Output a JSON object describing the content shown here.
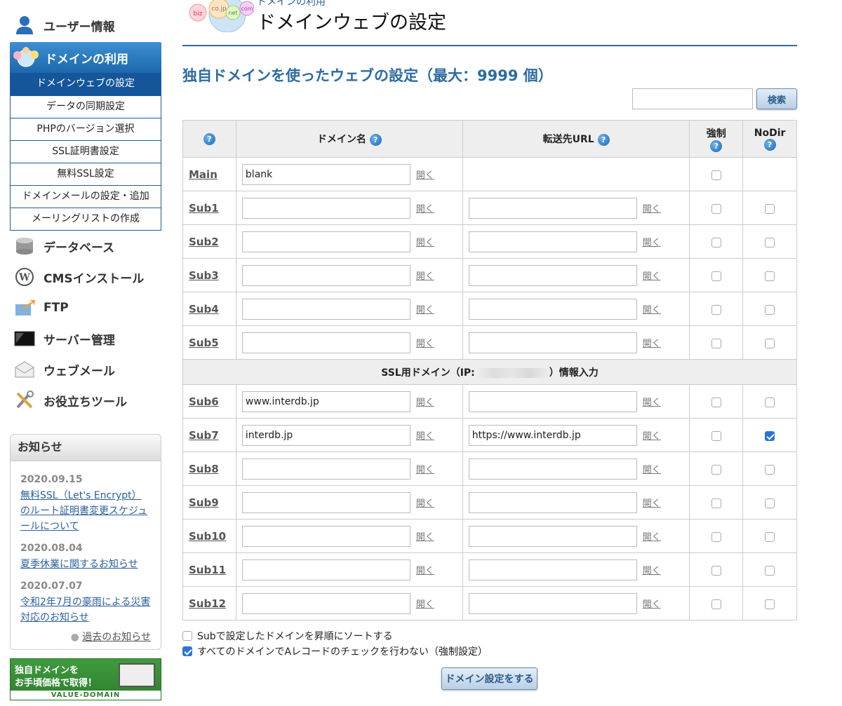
{
  "sidebar": {
    "user_info": "ユーザー情報",
    "domain_use": "ドメインの利用",
    "sub_items": [
      "ドメインウェブの設定",
      "データの同期設定",
      "PHPのバージョン選択",
      "SSL証明書設定",
      "無料SSL設定",
      "ドメインメールの設定・追加",
      "メーリングリストの作成"
    ],
    "main_items": [
      "データベース",
      "CMSインストール",
      "FTP",
      "サーバー管理",
      "ウェブメール",
      "お役立ちツール"
    ]
  },
  "news": {
    "title": "お知らせ",
    "items": [
      {
        "date": "2020.09.15",
        "text": "無料SSL（Let's Encrypt）のルート証明書変更スケジュールについて"
      },
      {
        "date": "2020.08.04",
        "text": "夏季休業に関するお知らせ"
      },
      {
        "date": "2020.07.07",
        "text": "令和2年7月の豪雨による災害対応のお知らせ"
      }
    ],
    "more": "過去のお知らせ"
  },
  "banner": {
    "line1": "独自ドメインを",
    "line2": "お手頃価格で取得！",
    "footer": "VALUE-DOMAIN"
  },
  "header": {
    "breadcrumb": "ドメインの利用",
    "title": "ドメインウェブの設定",
    "logo_words": [
      "biz",
      "co.jp",
      "net",
      "com"
    ]
  },
  "section_title": "独自ドメインを使ったウェブの設定（最大：9999 個）",
  "search": {
    "button": "検索",
    "value": ""
  },
  "table": {
    "headers": {
      "help": "?",
      "domain": "ドメイン名",
      "url": "転送先URL",
      "force": "強制",
      "nodir": "NoDir"
    },
    "open_label": "開く",
    "ssl_label_pre": "SSL用ドメイン（IP:",
    "ssl_label_post": "）情報入力",
    "rows": [
      {
        "label": "Main",
        "domain": "blank",
        "url": "",
        "force": false,
        "nodir": false
      },
      {
        "label": "Sub1",
        "domain": "",
        "url": "",
        "force": false,
        "nodir": false
      },
      {
        "label": "Sub2",
        "domain": "",
        "url": "",
        "force": false,
        "nodir": false
      },
      {
        "label": "Sub3",
        "domain": "",
        "url": "",
        "force": false,
        "nodir": false
      },
      {
        "label": "Sub4",
        "domain": "",
        "url": "",
        "force": false,
        "nodir": false
      },
      {
        "label": "Sub5",
        "domain": "",
        "url": "",
        "force": false,
        "nodir": false
      },
      {
        "label": "Sub6",
        "domain": "www.interdb.jp",
        "url": "",
        "force": false,
        "nodir": false
      },
      {
        "label": "Sub7",
        "domain": "interdb.jp",
        "url": "https://www.interdb.jp",
        "force": false,
        "nodir": true
      },
      {
        "label": "Sub8",
        "domain": "",
        "url": "",
        "force": false,
        "nodir": false
      },
      {
        "label": "Sub9",
        "domain": "",
        "url": "",
        "force": false,
        "nodir": false
      },
      {
        "label": "Sub10",
        "domain": "",
        "url": "",
        "force": false,
        "nodir": false
      },
      {
        "label": "Sub11",
        "domain": "",
        "url": "",
        "force": false,
        "nodir": false
      },
      {
        "label": "Sub12",
        "domain": "",
        "url": "",
        "force": false,
        "nodir": false
      }
    ]
  },
  "options": {
    "sort": {
      "label": "Subで設定したドメインを昇順にソートする",
      "checked": false
    },
    "no_a_check": {
      "label": "すべてのドメインでAレコードのチェックを行わない（強制設定）",
      "checked": true
    }
  },
  "submit_label": "ドメイン設定をする"
}
